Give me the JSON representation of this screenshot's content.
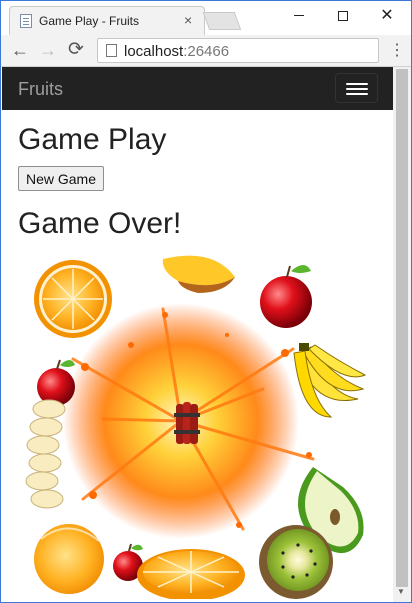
{
  "browser": {
    "tab_title": "Game Play - Fruits",
    "tab_close": "×",
    "url_host": "localhost",
    "url_port": ":26466",
    "back": "←",
    "forward": "→",
    "reload": "⟳",
    "menu": "⋮",
    "close_window": "✕"
  },
  "navbar": {
    "brand": "Fruits"
  },
  "page": {
    "heading": "Game Play",
    "new_game_label": "New Game",
    "status": "Game Over!"
  },
  "colors": {
    "navbar_bg": "#222222",
    "brand_text": "#9d9d9d",
    "heading_text": "#222222"
  },
  "scene": {
    "items": [
      "orange-half",
      "mango-slice",
      "apple",
      "apple",
      "banana-bunch",
      "banana-slices",
      "explosion",
      "dynamite",
      "green-apple-slice",
      "orange-half",
      "apple",
      "orange-slice",
      "kiwi-half"
    ]
  }
}
